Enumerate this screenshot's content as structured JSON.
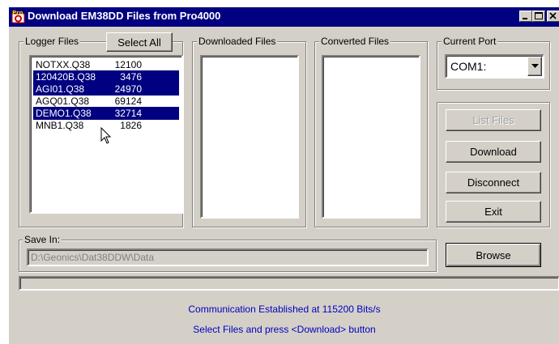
{
  "window": {
    "title": "Download EM38DD Files from Pro4000",
    "app_icon": "pro-app-icon",
    "controls": [
      "minimize-icon",
      "maximize-icon",
      "close-icon"
    ]
  },
  "logger_files": {
    "label": "Logger Files",
    "select_all_label": "Select All",
    "items": [
      {
        "name": "NOTXX.Q38",
        "size": "12100",
        "selected": false
      },
      {
        "name": "120420B.Q38",
        "size": "3476",
        "selected": true
      },
      {
        "name": "AGI01.Q38",
        "size": "24970",
        "selected": true
      },
      {
        "name": "AGQ01.Q38",
        "size": "69124",
        "selected": false
      },
      {
        "name": "DEMO1.Q38",
        "size": "32714",
        "selected": true
      },
      {
        "name": "MNB1.Q38",
        "size": "1826",
        "selected": false
      }
    ]
  },
  "downloaded_files": {
    "label": "Downloaded Files"
  },
  "converted_files": {
    "label": "Converted Files"
  },
  "current_port": {
    "label": "Current Port",
    "value": "COM1:"
  },
  "buttons": {
    "list_files": "List Files",
    "download": "Download",
    "disconnect": "Disconnect",
    "exit": "Exit",
    "browse": "Browse"
  },
  "save_in": {
    "label": "Save In:",
    "path": "D:\\Geonics\\Dat38DDW\\Data"
  },
  "status": {
    "line1": "Communication Established at 115200 Bits/s",
    "line2": "Select Files and press <Download> button"
  },
  "colors": {
    "selection": "#000080",
    "status_text": "#0000c0",
    "face": "#d4d0c8"
  }
}
